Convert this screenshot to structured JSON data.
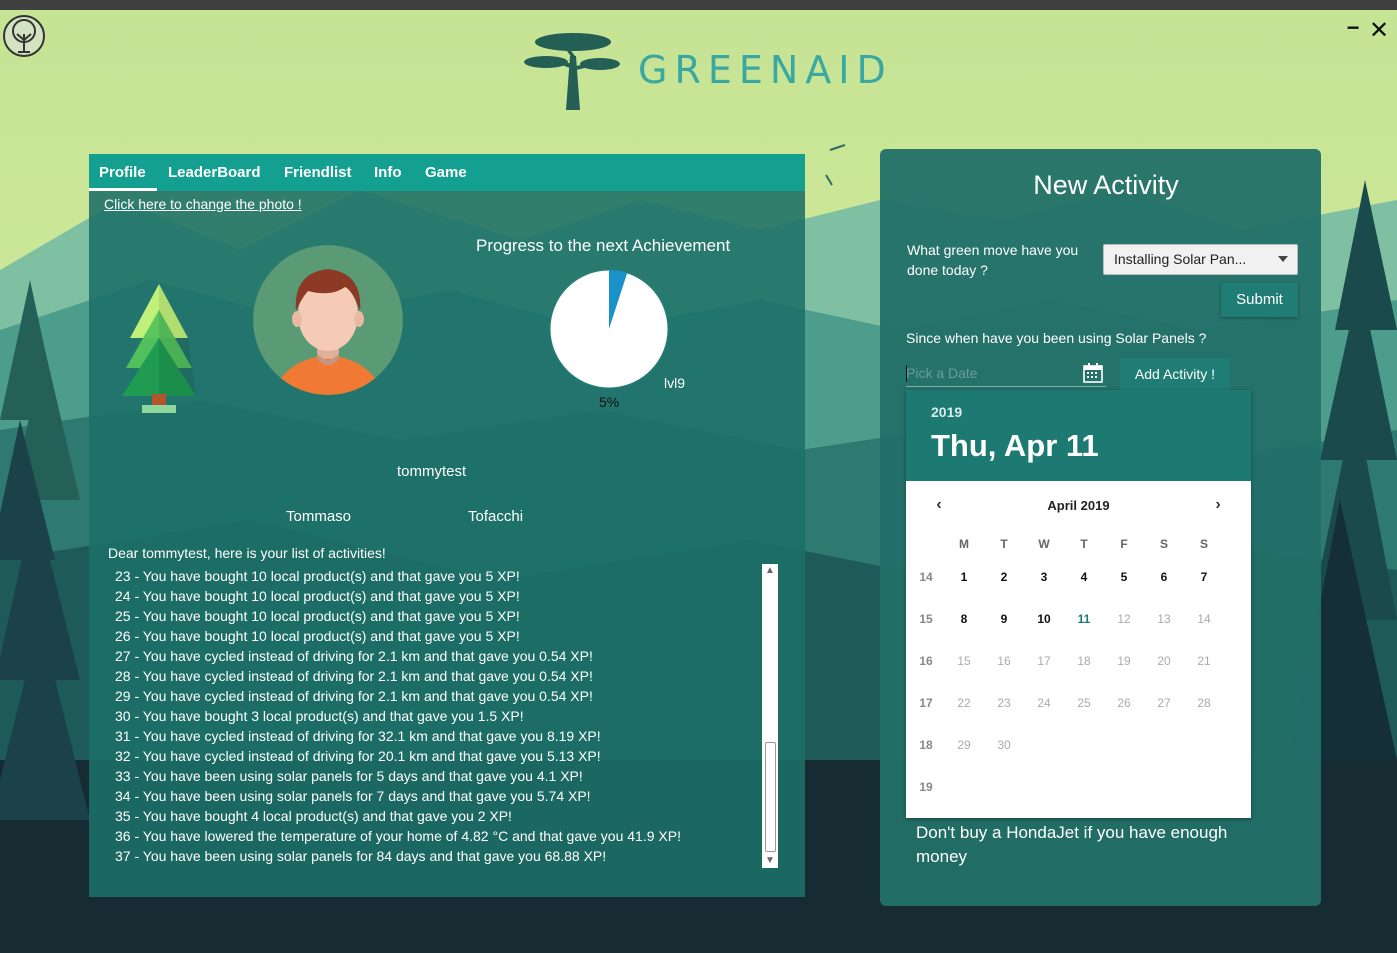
{
  "app": {
    "logo_text": "GREENAID"
  },
  "window": {
    "minimize": "−",
    "close": "✕"
  },
  "tabs": [
    {
      "label": "Profile",
      "active": true
    },
    {
      "label": "LeaderBoard",
      "active": false
    },
    {
      "label": "Friendlist",
      "active": false
    },
    {
      "label": "Info",
      "active": false
    },
    {
      "label": "Game",
      "active": false
    }
  ],
  "profile": {
    "change_photo_link": "Click here to change the photo !",
    "progress_title": "Progress to the next Achievement",
    "progress_percent": "5%",
    "progress_fraction": 0.05,
    "level": "lvl9",
    "username": "tommytest",
    "first_name": "Tommaso",
    "last_name": "Tofacchi",
    "list_title": "Dear tommytest, here is your list of activities!",
    "activities": [
      "23 - You have bought 10 local product(s) and that gave you 5 XP!",
      "24 - You have bought 10 local product(s) and that gave you 5 XP!",
      "25 - You have bought 10 local product(s) and that gave you 5 XP!",
      "26 - You have bought 10 local product(s) and that gave you 5 XP!",
      "27 - You have cycled instead of driving for 2.1 km and that gave you 0.54 XP!",
      "28 - You have cycled instead of driving for 2.1 km and that gave you 0.54 XP!",
      "29 - You have cycled instead of driving for 2.1 km and that gave you 0.54 XP!",
      "30 - You have bought 3 local product(s) and that gave you 1.5 XP!",
      "31 - You have cycled instead of driving for 32.1 km and that gave you 8.19 XP!",
      "32 - You have cycled instead of driving for 20.1 km and that gave you 5.13 XP!",
      "33 - You have been using solar panels for 5 days and that gave you 4.1 XP!",
      "34 - You have been using solar panels for 7 days and that gave you 5.74 XP!",
      "35 - You have bought 4 local product(s) and that gave you 2 XP!",
      "36 - You have lowered the temperature of your home of 4.82 °C and that gave you 41.9 XP!",
      "37 - You have been using solar panels for 84 days and that gave you 68.88 XP!"
    ]
  },
  "new_activity": {
    "title": "New Activity",
    "question": "What green move have you done today ?",
    "selected_activity": "Installing Solar Pan...",
    "submit_label": "Submit",
    "since_question": "Since when have you been using Solar Panels ?",
    "date_placeholder": "Pick a Date",
    "add_label": "Add Activity !",
    "tip": "Don't buy a HondaJet if you have enough money"
  },
  "datepicker": {
    "year": "2019",
    "selected_date": "Thu, Apr 11",
    "month_label": "April 2019",
    "weekdays": [
      "M",
      "T",
      "W",
      "T",
      "F",
      "S",
      "S"
    ],
    "weeks": [
      {
        "week": "14",
        "days": [
          "1",
          "2",
          "3",
          "4",
          "5",
          "6",
          "7"
        ]
      },
      {
        "week": "15",
        "days": [
          "8",
          "9",
          "10",
          "11",
          "12",
          "13",
          "14"
        ]
      },
      {
        "week": "16",
        "days": [
          "15",
          "16",
          "17",
          "18",
          "19",
          "20",
          "21"
        ]
      },
      {
        "week": "17",
        "days": [
          "22",
          "23",
          "24",
          "25",
          "26",
          "27",
          "28"
        ]
      },
      {
        "week": "18",
        "days": [
          "29",
          "30"
        ]
      },
      {
        "week": "19",
        "days": []
      }
    ],
    "today": "11",
    "accent_color": "#1d7a72"
  },
  "colors": {
    "sky": "#c6e495",
    "tab_bar": "#14a091",
    "panel": "#1f7068",
    "logo_text": "#3aa8a0"
  }
}
